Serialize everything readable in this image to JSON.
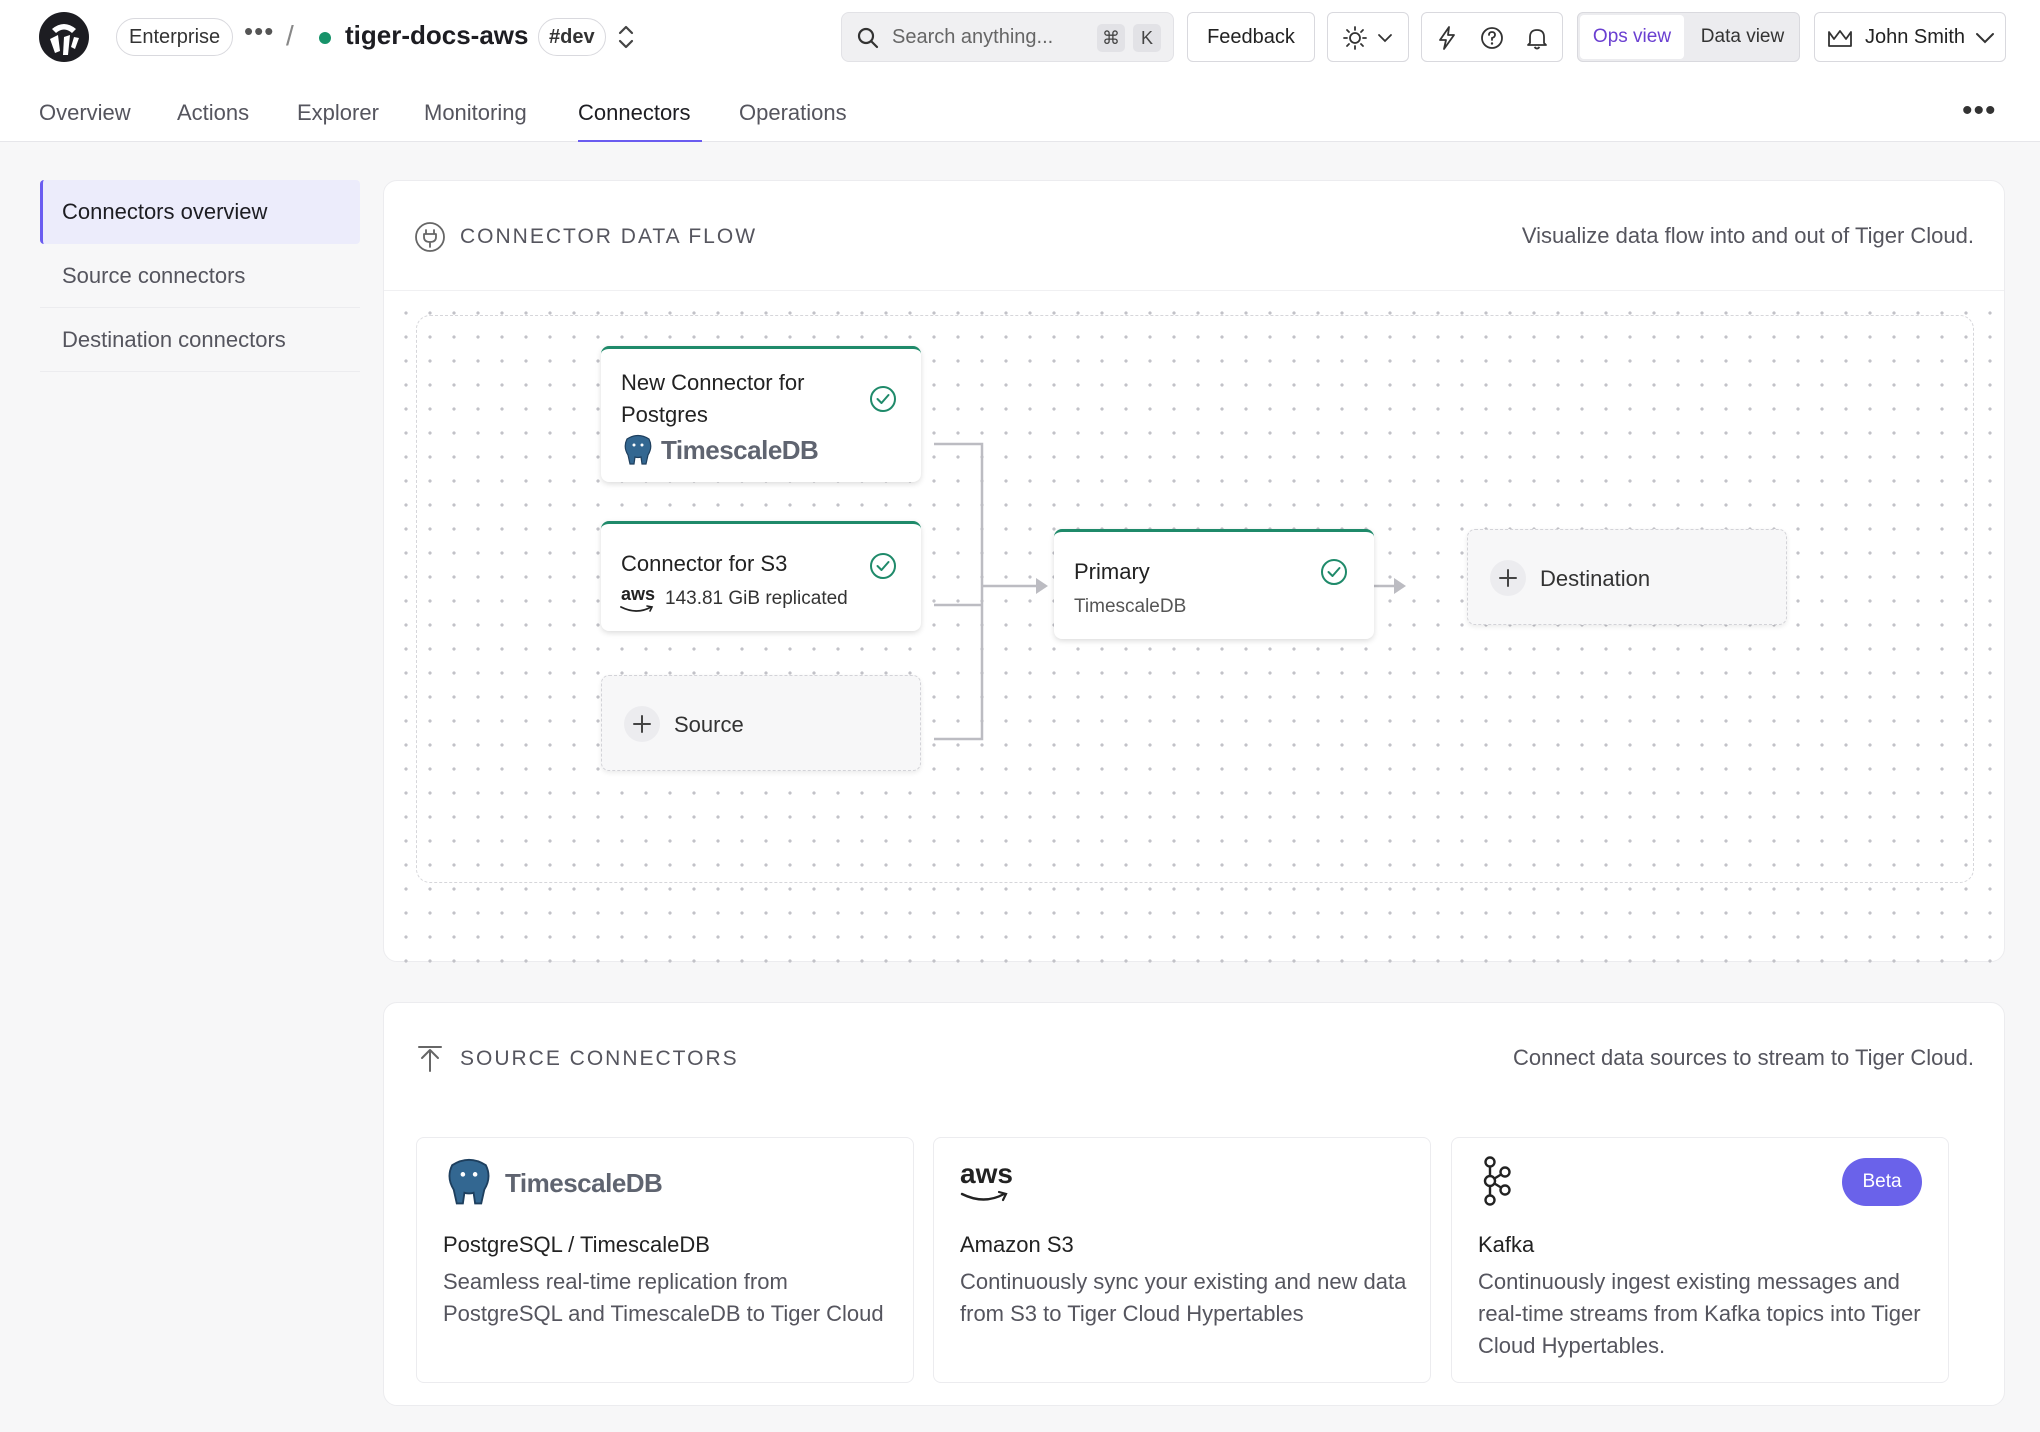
{
  "header": {
    "org": "Enterprise",
    "more": "•••",
    "separator": "/",
    "service_name": "tiger-docs-aws",
    "env": "#dev",
    "search_placeholder": "Search anything...",
    "kbd_cmd": "⌘",
    "kbd_k": "K",
    "feedback": "Feedback",
    "ops_view": "Ops view",
    "data_view": "Data view",
    "user_name": "John Smith",
    "status_color": "#17936a"
  },
  "tabs": [
    "Overview",
    "Actions",
    "Explorer",
    "Monitoring",
    "Connectors",
    "Operations"
  ],
  "active_tab": "Connectors",
  "sidebar": {
    "items": [
      {
        "label": "Connectors overview",
        "active": true
      },
      {
        "label": "Source connectors",
        "active": false
      },
      {
        "label": "Destination connectors",
        "active": false
      }
    ]
  },
  "flow": {
    "title": "CONNECTOR DATA FLOW",
    "description": "Visualize data flow into and out of Tiger Cloud.",
    "sources": [
      {
        "title_line1": "New Connector for",
        "title_line2": "Postgres",
        "logo_text": "TimescaleDB"
      },
      {
        "title": "Connector for S3",
        "logo_text": "aws",
        "detail": "143.81 GiB replicated"
      }
    ],
    "add_source": "Source",
    "primary": {
      "title": "Primary",
      "subtitle": "TimescaleDB"
    },
    "add_destination": "Destination"
  },
  "source_connectors": {
    "title": "SOURCE CONNECTORS",
    "description": "Connect data sources to stream to Tiger Cloud.",
    "cards": [
      {
        "logo_text": "TimescaleDB",
        "title": "PostgreSQL / TimescaleDB",
        "description": "Seamless real-time replication from PostgreSQL and TimescaleDB to Tiger Cloud"
      },
      {
        "logo_text": "aws",
        "title": "Amazon S3",
        "description": "Continuously sync your existing and new data from S3 to Tiger Cloud Hypertables"
      },
      {
        "badge": "Beta",
        "title": "Kafka",
        "description": "Continuously ingest existing messages and real-time streams from Kafka topics into Tiger Cloud Hypertables."
      }
    ]
  },
  "colors": {
    "accent": "#6a5cf0",
    "success": "#1f8a6a",
    "beta": "#6a62ea"
  }
}
